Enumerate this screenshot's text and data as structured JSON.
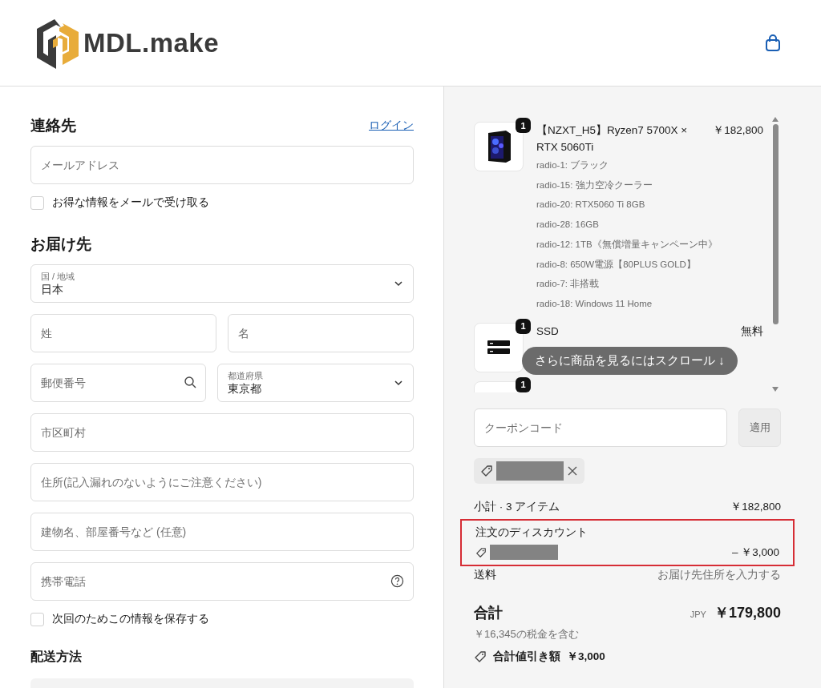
{
  "header": {
    "logo_text": "MDL.make"
  },
  "contact": {
    "title": "連絡先",
    "login_link": "ログイン",
    "email": {
      "placeholder": "メールアドレス"
    },
    "newsletter": {
      "label": "お得な情報をメールで受け取る",
      "checked": false
    }
  },
  "delivery": {
    "title": "お届け先",
    "rows": [
      [
        {
          "kind": "select",
          "label": "国 / 地域",
          "value": "日本"
        }
      ],
      [
        {
          "kind": "text",
          "placeholder": "姓"
        },
        {
          "kind": "text",
          "placeholder": "名"
        }
      ],
      [
        {
          "kind": "search",
          "placeholder": "郵便番号"
        },
        {
          "kind": "select",
          "label": "都道府県",
          "value": "東京都"
        }
      ],
      [
        {
          "kind": "text",
          "placeholder": "市区町村"
        }
      ],
      [
        {
          "kind": "text",
          "placeholder": "住所(記入漏れのないようにご注意ください)"
        }
      ],
      [
        {
          "kind": "text",
          "placeholder": "建物名、部屋番号など (任意)"
        }
      ],
      [
        {
          "kind": "help",
          "placeholder": "携帯電話"
        }
      ]
    ],
    "save_info": {
      "label": "次回のためこの情報を保存する",
      "checked": false
    }
  },
  "shipping": {
    "title": "配送方法"
  },
  "summary": {
    "items": [
      {
        "kind": "case",
        "quantity": "1",
        "name": "【NZXT_H5】Ryzen7 5700X × RTX 5060Ti",
        "price": "￥182,800",
        "options": [
          "radio-1: ブラック",
          "radio-15: 強力空冷クーラー",
          "radio-20: RTX5060 Ti 8GB",
          "radio-28: 16GB",
          "radio-12: 1TB《無償増量キャンペーン中》",
          "radio-8: 650W電源【80PLUS GOLD】",
          "radio-7: 非搭載",
          "radio-18: Windows 11 Home"
        ]
      },
      {
        "kind": "ssd",
        "quantity": "1",
        "name": "SSD",
        "price": "無料"
      },
      {
        "kind": "blank",
        "quantity": "1"
      }
    ],
    "scroll_hint": "さらに商品を見るにはスクロール ↓",
    "coupon": {
      "placeholder": "クーポンコード",
      "apply": "適用"
    },
    "subtotal": {
      "label": "小計 · 3 アイテム",
      "value": "￥182,800"
    },
    "discount": {
      "label": "注文のディスカウント",
      "value": "– ￥3,000",
      "highlighted": true
    },
    "shipping": {
      "label": "送料",
      "value": "お届け先住所を入力する"
    },
    "total": {
      "label": "合計",
      "currency": "JPY",
      "value": "￥179,800",
      "tax_note": "￥16,345の税金を含む"
    },
    "savings": {
      "label": "合計値引き額",
      "value": "￥3,000"
    }
  }
}
